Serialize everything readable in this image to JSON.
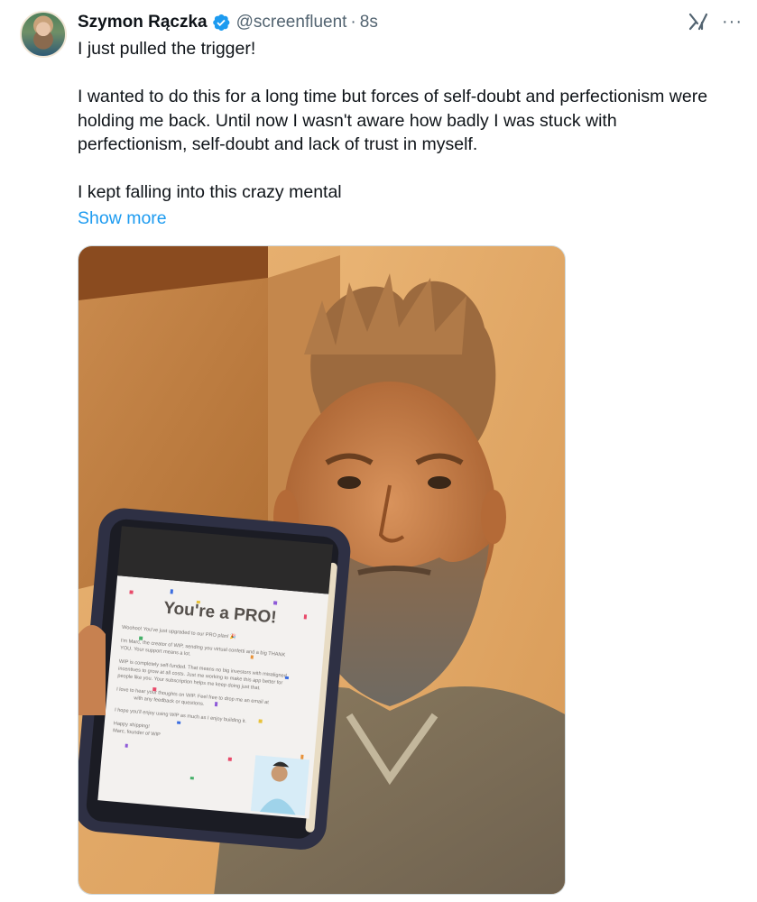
{
  "author": {
    "name": "Szymon Rączka",
    "handle": "@screenfluent",
    "separator": "·",
    "time": "8s"
  },
  "icons": {
    "verified": "verified-badge-icon",
    "grok": "grok-icon",
    "more": "more-options-icon",
    "more_glyph": "···"
  },
  "tweet": {
    "line1": "I just pulled the trigger!",
    "paragraph2": "I wanted to do this for a long time but forces of self-doubt and perfectionism were holding me back. Until now I wasn't aware how badly I was stuck with perfectionism, self-doubt and lack of trust in myself.",
    "paragraph3": "I kept falling into this crazy mental",
    "show_more": "Show more"
  },
  "media": {
    "tablet_screen": {
      "title": "You're a PRO!",
      "lines": [
        "Woohoo! You've just upgraded to our PRO plan! 🎉",
        "I'm Marc, the creator of WIP, sending you virtual confetti and a big THANK",
        "YOU. Your support means a lot.",
        "WIP is completely self-funded. That means no big investors with misaligned",
        "incentives to grow at all costs. Just me working to make this app better for",
        "people like you. Your subscription helps me keep doing just that.",
        "I love to hear your thoughts on WIP. Feel free to drop me an email at",
        "with any feedback or questions.",
        "I hope you'll enjoy using WIP as much as I enjoy building it.",
        "Happy shipping!",
        "Marc, founder of WIP"
      ]
    }
  },
  "colors": {
    "link": "#1d9bf0",
    "verified": "#1d9bf0",
    "secondary_text": "#536471"
  }
}
